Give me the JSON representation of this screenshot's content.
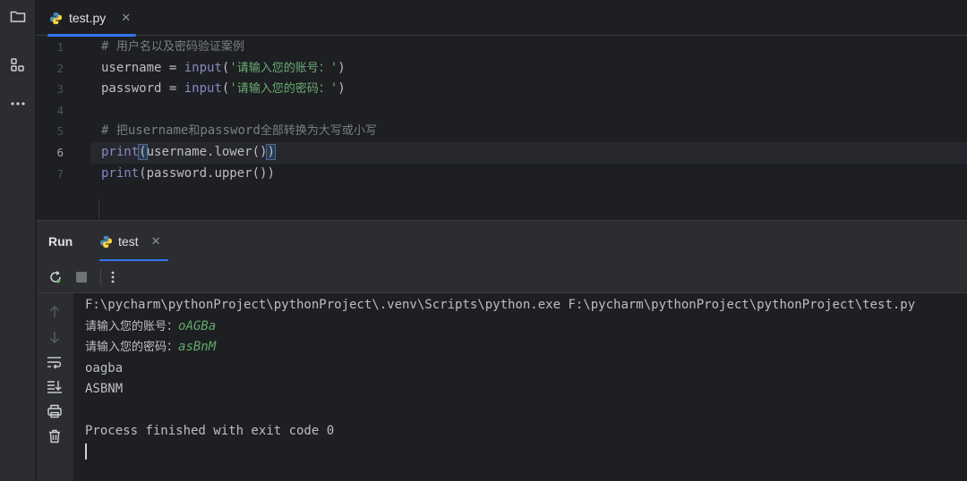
{
  "activity_bar": {
    "items": [
      {
        "icon": "folder-icon"
      },
      {
        "icon": "structure-icon"
      },
      {
        "icon": "more-icon"
      }
    ]
  },
  "editor": {
    "tab": {
      "label": "test.py",
      "icon": "python-file-icon"
    },
    "current_line": 6,
    "line_numbers": [
      "1",
      "2",
      "3",
      "4",
      "5",
      "6",
      "7"
    ],
    "lines": [
      {
        "comment_hash": "# ",
        "comment_text": "用户名以及密码验证案例"
      },
      {
        "var": "username",
        "op": " = ",
        "fn": "input",
        "open": "(",
        "str_quote_open": "'",
        "str_text": "请输入您的账号：",
        "str_quote_close": "'",
        "close": ")"
      },
      {
        "var": "password",
        "op": " = ",
        "fn": "input",
        "open": "(",
        "str_quote_open": "'",
        "str_text": "请输入您的密码：",
        "str_quote_close": "'",
        "close": ")"
      },
      {},
      {
        "comment_hash": "# ",
        "comment_a": "把",
        "comment_b": "username",
        "comment_c": "和",
        "comment_d": "password",
        "comment_e": "全部转换为大写或小写"
      },
      {
        "fn": "print",
        "open": "(",
        "body": "username.lower()",
        "close": ")"
      },
      {
        "fn": "print",
        "body": "(password.upper())"
      }
    ]
  },
  "run_panel": {
    "title": "Run",
    "tab": {
      "label": "test",
      "icon": "python-run-icon"
    },
    "toolbar": [
      {
        "icon": "rerun-icon"
      },
      {
        "icon": "stop-icon"
      },
      {
        "icon": "more-vertical-icon"
      }
    ],
    "side": [
      {
        "icon": "arrow-up-icon"
      },
      {
        "icon": "arrow-down-icon"
      },
      {
        "icon": "soft-wrap-icon"
      },
      {
        "icon": "scroll-to-end-icon"
      },
      {
        "icon": "print-icon"
      },
      {
        "icon": "trash-icon"
      }
    ]
  },
  "console": {
    "command": "F:\\pycharm\\pythonProject\\pythonProject\\.venv\\Scripts\\python.exe F:\\pycharm\\pythonProject\\pythonProject\\test.py",
    "prompt1": "请输入您的账号：",
    "input1": "oAGBa",
    "prompt2": "请输入您的密码：",
    "input2": "asBnM",
    "out1": "oagba",
    "out2": "ASBNM",
    "exit": "Process finished with exit code 0"
  },
  "colors": {
    "accent": "#3574f0",
    "background": "#1e1f22",
    "panel": "#2b2d30",
    "string": "#6aab73",
    "builtin": "#8888c6",
    "comment": "#7a7e85"
  }
}
